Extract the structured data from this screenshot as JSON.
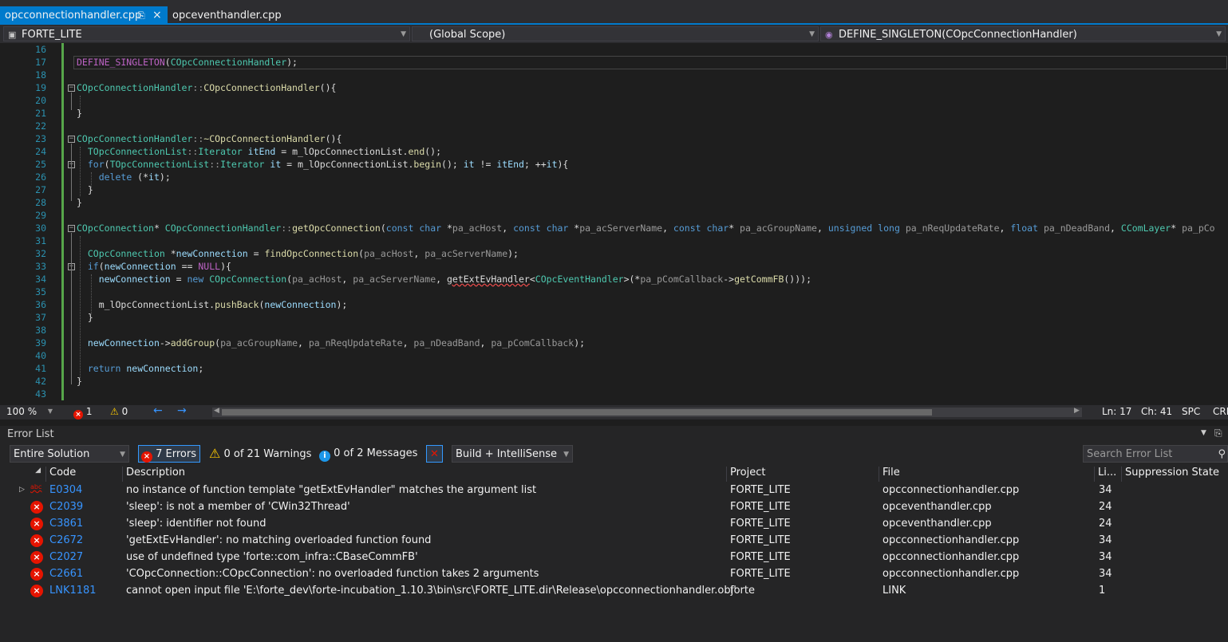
{
  "tabs": [
    {
      "label": "opcconnectionhandler.cpp",
      "active": true
    },
    {
      "label": "opceventhandler.cpp",
      "active": false
    }
  ],
  "nav": {
    "project": "FORTE_LITE",
    "scope": "(Global Scope)",
    "member": "DEFINE_SINGLETON(COpcConnectionHandler)"
  },
  "editor": {
    "line_numbers": [
      "16",
      "17",
      "18",
      "19",
      "20",
      "21",
      "22",
      "23",
      "24",
      "25",
      "26",
      "27",
      "28",
      "29",
      "30",
      "31",
      "32",
      "33",
      "34",
      "35",
      "36",
      "37",
      "38",
      "39",
      "40",
      "41",
      "42",
      "43"
    ],
    "lines": [
      [],
      [
        [
          "mac",
          "DEFINE_SINGLETON"
        ],
        [
          "pv",
          "("
        ],
        [
          "ty",
          "COpcConnectionHandler"
        ],
        [
          "pv",
          ");"
        ]
      ],
      [],
      [
        [
          "ty",
          "COpcConnectionHandler"
        ],
        [
          "par",
          "::"
        ],
        [
          "fn",
          "COpcConnectionHandler"
        ],
        [
          "pv",
          "(){"
        ]
      ],
      [],
      [
        [
          "pv",
          "}"
        ]
      ],
      [],
      [
        [
          "ty",
          "COpcConnectionHandler"
        ],
        [
          "par",
          "::"
        ],
        [
          "fn",
          "~COpcConnectionHandler"
        ],
        [
          "pv",
          "(){"
        ]
      ],
      [
        [
          "pv",
          "  "
        ],
        [
          "ty",
          "TOpcConnectionList"
        ],
        [
          "par",
          "::"
        ],
        [
          "ty",
          "Iterator"
        ],
        [
          "pv",
          " "
        ],
        [
          "var",
          "itEnd"
        ],
        [
          "pv",
          " = m_lOpcConnectionList."
        ],
        [
          "fn",
          "end"
        ],
        [
          "pv",
          "();"
        ]
      ],
      [
        [
          "pv",
          "  "
        ],
        [
          "kw",
          "for"
        ],
        [
          "pv",
          "("
        ],
        [
          "ty",
          "TOpcConnectionList"
        ],
        [
          "par",
          "::"
        ],
        [
          "ty",
          "Iterator"
        ],
        [
          "pv",
          " "
        ],
        [
          "var",
          "it"
        ],
        [
          "pv",
          " = m_lOpcConnectionList."
        ],
        [
          "fn",
          "begin"
        ],
        [
          "pv",
          "(); "
        ],
        [
          "var",
          "it"
        ],
        [
          "pv",
          " != "
        ],
        [
          "var",
          "itEnd"
        ],
        [
          "pv",
          "; ++"
        ],
        [
          "var",
          "it"
        ],
        [
          "pv",
          "){"
        ]
      ],
      [
        [
          "pv",
          "    "
        ],
        [
          "kw",
          "delete"
        ],
        [
          "pv",
          " (*"
        ],
        [
          "var",
          "it"
        ],
        [
          "pv",
          ");"
        ]
      ],
      [
        [
          "pv",
          "  }"
        ]
      ],
      [
        [
          "pv",
          "}"
        ]
      ],
      [],
      [
        [
          "ty",
          "COpcConnection"
        ],
        [
          "pv",
          "* "
        ],
        [
          "ty",
          "COpcConnectionHandler"
        ],
        [
          "par",
          "::"
        ],
        [
          "fn",
          "getOpcConnection"
        ],
        [
          "pv",
          "("
        ],
        [
          "kw",
          "const"
        ],
        [
          "pv",
          " "
        ],
        [
          "kw",
          "char"
        ],
        [
          "pv",
          " *"
        ],
        [
          "par",
          "pa_acHost"
        ],
        [
          "pv",
          ", "
        ],
        [
          "kw",
          "const"
        ],
        [
          "pv",
          " "
        ],
        [
          "kw",
          "char"
        ],
        [
          "pv",
          " *"
        ],
        [
          "par",
          "pa_acServerName"
        ],
        [
          "pv",
          ", "
        ],
        [
          "kw",
          "const"
        ],
        [
          "pv",
          " "
        ],
        [
          "kw",
          "char"
        ],
        [
          "pv",
          "* "
        ],
        [
          "par",
          "pa_acGroupName"
        ],
        [
          "pv",
          ", "
        ],
        [
          "kw",
          "unsigned"
        ],
        [
          "pv",
          " "
        ],
        [
          "kw",
          "long"
        ],
        [
          "pv",
          " "
        ],
        [
          "par",
          "pa_nReqUpdateRate"
        ],
        [
          "pv",
          ", "
        ],
        [
          "kw",
          "float"
        ],
        [
          "pv",
          " "
        ],
        [
          "par",
          "pa_nDeadBand"
        ],
        [
          "pv",
          ", "
        ],
        [
          "ty",
          "CComLayer"
        ],
        [
          "pv",
          "* "
        ],
        [
          "par",
          "pa_pCo"
        ]
      ],
      [],
      [
        [
          "pv",
          "  "
        ],
        [
          "ty",
          "COpcConnection"
        ],
        [
          "pv",
          " *"
        ],
        [
          "var",
          "newConnection"
        ],
        [
          "pv",
          " = "
        ],
        [
          "fn",
          "findOpcConnection"
        ],
        [
          "pv",
          "("
        ],
        [
          "par",
          "pa_acHost"
        ],
        [
          "pv",
          ", "
        ],
        [
          "par",
          "pa_acServerName"
        ],
        [
          "pv",
          ");"
        ]
      ],
      [
        [
          "pv",
          "  "
        ],
        [
          "kw",
          "if"
        ],
        [
          "pv",
          "("
        ],
        [
          "var",
          "newConnection"
        ],
        [
          "pv",
          " == "
        ],
        [
          "mac",
          "NULL"
        ],
        [
          "pv",
          "){"
        ]
      ],
      [
        [
          "pv",
          "    "
        ],
        [
          "var",
          "newConnection"
        ],
        [
          "pv",
          " = "
        ],
        [
          "kw",
          "new"
        ],
        [
          "pv",
          " "
        ],
        [
          "ty",
          "COpcConnection"
        ],
        [
          "pv",
          "("
        ],
        [
          "par",
          "pa_acHost"
        ],
        [
          "pv",
          ", "
        ],
        [
          "par",
          "pa_acServerName"
        ],
        [
          "pv",
          ", "
        ],
        [
          "sq",
          "getExtEvHandler"
        ],
        [
          "pv",
          "<"
        ],
        [
          "ty",
          "COpcEventHandler"
        ],
        [
          "pv",
          ">(*"
        ],
        [
          "par",
          "pa_pComCallback"
        ],
        [
          "pv",
          "->"
        ],
        [
          "fn",
          "getCommFB"
        ],
        [
          "pv",
          "()));"
        ]
      ],
      [],
      [
        [
          "pv",
          "    m_lOpcConnectionList."
        ],
        [
          "fn",
          "pushBack"
        ],
        [
          "pv",
          "("
        ],
        [
          "var",
          "newConnection"
        ],
        [
          "pv",
          ");"
        ]
      ],
      [
        [
          "pv",
          "  }"
        ]
      ],
      [],
      [
        [
          "pv",
          "  "
        ],
        [
          "var",
          "newConnection"
        ],
        [
          "pv",
          "->"
        ],
        [
          "fn",
          "addGroup"
        ],
        [
          "pv",
          "("
        ],
        [
          "par",
          "pa_acGroupName"
        ],
        [
          "pv",
          ", "
        ],
        [
          "par",
          "pa_nReqUpdateRate"
        ],
        [
          "pv",
          ", "
        ],
        [
          "par",
          "pa_nDeadBand"
        ],
        [
          "pv",
          ", "
        ],
        [
          "par",
          "pa_pComCallback"
        ],
        [
          "pv",
          ");"
        ]
      ],
      [],
      [
        [
          "pv",
          "  "
        ],
        [
          "kw",
          "return"
        ],
        [
          "pv",
          " "
        ],
        [
          "var",
          "newConnection"
        ],
        [
          "pv",
          ";"
        ]
      ],
      [
        [
          "pv",
          "}"
        ]
      ],
      []
    ]
  },
  "editor_status": {
    "zoom": "100 %",
    "errors": "1",
    "warnings": "0",
    "line": "Ln: 17",
    "col": "Ch: 41",
    "spc": "SPC",
    "crlf": "CRL"
  },
  "error_list": {
    "title": "Error List",
    "scope": "Entire Solution",
    "errors_label": "7 Errors",
    "warnings_label": "0 of 21 Warnings",
    "messages_label": "0 of 2 Messages",
    "build_filter": "Build + IntelliSense",
    "search_placeholder": "Search Error List",
    "columns": {
      "code": "Code",
      "description": "Description",
      "project": "Project",
      "file": "File",
      "line": "Li...",
      "suppression": "Suppression State"
    },
    "rows": [
      {
        "code": "E0304",
        "description": "no instance of function template \"getExtEvHandler\" matches the argument list",
        "project": "FORTE_LITE",
        "file": "opcconnectionhandler.cpp",
        "line": "34",
        "icon": "intellisense-icon"
      },
      {
        "code": "C2039",
        "description": "'sleep': is not a member of 'CWin32Thread'",
        "project": "FORTE_LITE",
        "file": "opceventhandler.cpp",
        "line": "24",
        "icon": "error-icon"
      },
      {
        "code": "C3861",
        "description": "'sleep': identifier not found",
        "project": "FORTE_LITE",
        "file": "opceventhandler.cpp",
        "line": "24",
        "icon": "error-icon"
      },
      {
        "code": "C2672",
        "description": "'getExtEvHandler': no matching overloaded function found",
        "project": "FORTE_LITE",
        "file": "opcconnectionhandler.cpp",
        "line": "34",
        "icon": "error-icon"
      },
      {
        "code": "C2027",
        "description": "use of undefined type 'forte::com_infra::CBaseCommFB'",
        "project": "FORTE_LITE",
        "file": "opcconnectionhandler.cpp",
        "line": "34",
        "icon": "error-icon"
      },
      {
        "code": "C2661",
        "description": "'COpcConnection::COpcConnection': no overloaded function takes 2 arguments",
        "project": "FORTE_LITE",
        "file": "opcconnectionhandler.cpp",
        "line": "34",
        "icon": "error-icon"
      },
      {
        "code": "LNK1181",
        "description": "cannot open input file 'E:\\forte_dev\\forte-incubation_1.10.3\\bin\\src\\FORTE_LITE.dir\\Release\\opcconnectionhandler.obj'",
        "project": "forte",
        "file": "LINK",
        "line": "1",
        "icon": "error-icon"
      }
    ]
  }
}
